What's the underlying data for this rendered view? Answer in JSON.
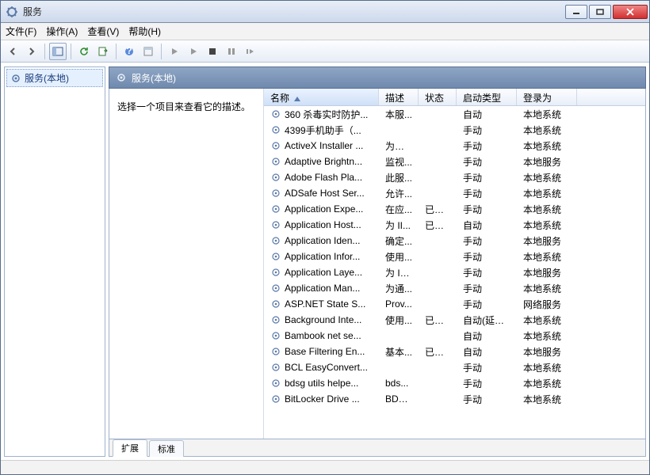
{
  "window": {
    "title": "服务"
  },
  "menu": {
    "file": "文件(F)",
    "action": "操作(A)",
    "view": "查看(V)",
    "help": "帮助(H)"
  },
  "tree": {
    "root": "服务(本地)"
  },
  "panel": {
    "header": "服务(本地)",
    "desc_prompt": "选择一个项目来查看它的描述。"
  },
  "columns": {
    "name": "名称",
    "desc": "描述",
    "status": "状态",
    "startup": "启动类型",
    "logon": "登录为"
  },
  "tabs": {
    "extended": "扩展",
    "standard": "标准"
  },
  "services": [
    {
      "name": "360 杀毒实时防护...",
      "desc": "本服...",
      "status": "",
      "startup": "自动",
      "logon": "本地系统"
    },
    {
      "name": "4399手机助手（...",
      "desc": "",
      "status": "",
      "startup": "手动",
      "logon": "本地系统"
    },
    {
      "name": "ActiveX Installer ...",
      "desc": "为从 ...",
      "status": "",
      "startup": "手动",
      "logon": "本地系统"
    },
    {
      "name": "Adaptive Brightn...",
      "desc": "监视...",
      "status": "",
      "startup": "手动",
      "logon": "本地服务"
    },
    {
      "name": "Adobe Flash Pla...",
      "desc": "此服...",
      "status": "",
      "startup": "手动",
      "logon": "本地系统"
    },
    {
      "name": "ADSafe Host Ser...",
      "desc": "允许...",
      "status": "",
      "startup": "手动",
      "logon": "本地系统"
    },
    {
      "name": "Application Expe...",
      "desc": "在应...",
      "status": "已启动",
      "startup": "手动",
      "logon": "本地系统"
    },
    {
      "name": "Application Host...",
      "desc": "为 II...",
      "status": "已启动",
      "startup": "自动",
      "logon": "本地系统"
    },
    {
      "name": "Application Iden...",
      "desc": "确定...",
      "status": "",
      "startup": "手动",
      "logon": "本地服务"
    },
    {
      "name": "Application Infor...",
      "desc": "使用...",
      "status": "",
      "startup": "手动",
      "logon": "本地系统"
    },
    {
      "name": "Application Laye...",
      "desc": "为 In...",
      "status": "",
      "startup": "手动",
      "logon": "本地服务"
    },
    {
      "name": "Application Man...",
      "desc": "为通...",
      "status": "",
      "startup": "手动",
      "logon": "本地系统"
    },
    {
      "name": "ASP.NET State S...",
      "desc": "Prov...",
      "status": "",
      "startup": "手动",
      "logon": "网络服务"
    },
    {
      "name": "Background Inte...",
      "desc": "使用...",
      "status": "已启动",
      "startup": "自动(延迟...",
      "logon": "本地系统"
    },
    {
      "name": "Bambook net se...",
      "desc": "",
      "status": "",
      "startup": "自动",
      "logon": "本地系统"
    },
    {
      "name": "Base Filtering En...",
      "desc": "基本...",
      "status": "已启动",
      "startup": "自动",
      "logon": "本地服务"
    },
    {
      "name": "BCL EasyConvert...",
      "desc": "",
      "status": "",
      "startup": "手动",
      "logon": "本地系统"
    },
    {
      "name": "bdsg utils helpe...",
      "desc": "bds...",
      "status": "",
      "startup": "手动",
      "logon": "本地系统"
    },
    {
      "name": "BitLocker Drive ...",
      "desc": "BDE...",
      "status": "",
      "startup": "手动",
      "logon": "本地系统"
    }
  ]
}
